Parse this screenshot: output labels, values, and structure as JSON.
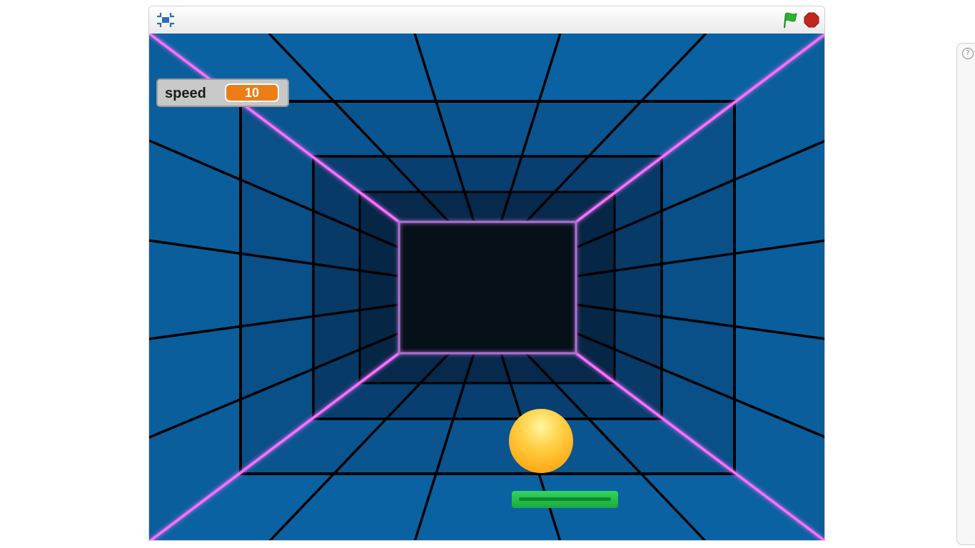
{
  "toolbar": {
    "fullscreen_icon": "fullscreen-icon",
    "flag_icon": "green-flag-icon",
    "stop_icon": "stop-sign-icon"
  },
  "monitor": {
    "label": "speed",
    "value": "10"
  },
  "side_panel": {
    "help_label": "?"
  },
  "colors": {
    "flag": "#2eb22e",
    "stop": "#c0281b",
    "monitor_value_bg": "#ee7d16",
    "tunnel_tile": "#0b62a2",
    "neon": "#ff70ff",
    "ball": "#ffb21f",
    "paddle": "#1fbf45"
  }
}
